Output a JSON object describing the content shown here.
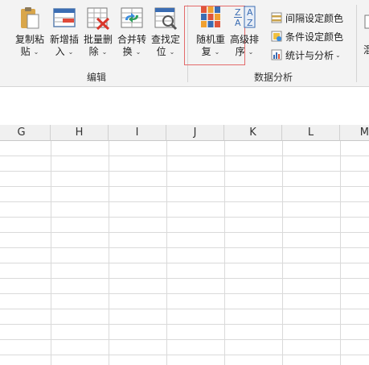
{
  "ribbon": {
    "groups": {
      "edit": "编辑",
      "data_analysis": "数据分析"
    },
    "edit_buttons": [
      {
        "line1": "复制粘",
        "line2": "贴"
      },
      {
        "line1": "新增插",
        "line2": "入"
      },
      {
        "line1": "批量删",
        "line2": "除"
      },
      {
        "line1": "合并转",
        "line2": "换"
      },
      {
        "line1": "查找定",
        "line2": "位"
      }
    ],
    "analysis_buttons": [
      {
        "line1": "随机重",
        "line2": "复"
      },
      {
        "line1": "高级排",
        "line2": "序"
      }
    ],
    "small_buttons": [
      {
        "label": "间隔设定颜色"
      },
      {
        "label": "条件设定颜色"
      },
      {
        "label": "统计与分析"
      }
    ],
    "cut_off_label": "混"
  },
  "columns": [
    "G",
    "H",
    "I",
    "J",
    "K",
    "L",
    "M"
  ],
  "colors": {
    "highlight_border": "#e36a6a",
    "ribbon_bg": "#f3f3f3",
    "grid_line": "#dadada"
  }
}
